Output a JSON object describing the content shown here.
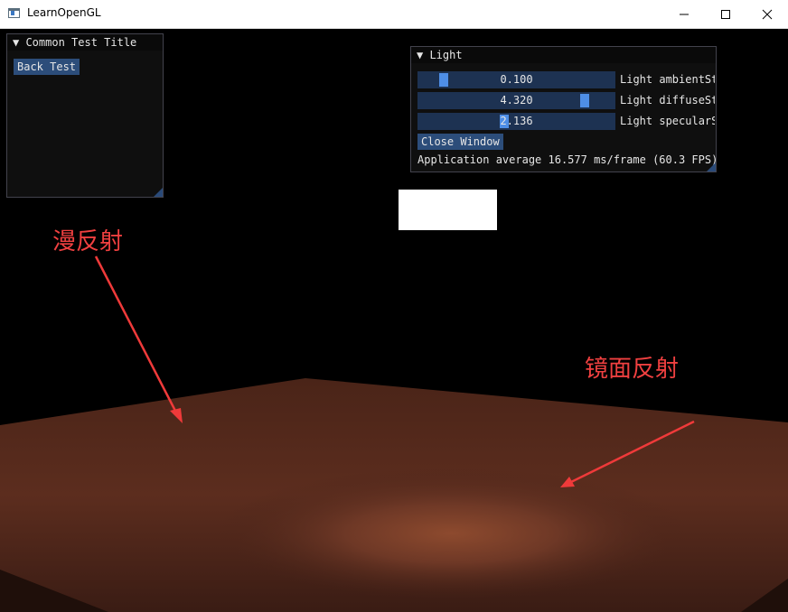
{
  "window": {
    "title": "LearnOpenGL"
  },
  "common_panel": {
    "header": "▼ Common Test Title",
    "back_button": "Back Test"
  },
  "light_panel": {
    "header": "▼ Light",
    "sliders": [
      {
        "value": "0.100",
        "label": "Light ambientSt",
        "level": 0.1
      },
      {
        "value": "4.320",
        "label": "Light diffuseSt",
        "level": 0.86
      },
      {
        "value": "2.136",
        "label": "Light specularS",
        "level": 0.43
      }
    ],
    "close_button": "Close Window",
    "stats": "Application average 16.577 ms/frame (60.3 FPS)"
  },
  "annotations": {
    "diffuse": "漫反射",
    "specular": "镜面反射"
  },
  "colors": {
    "annotation": "#f04040",
    "plane": "#6b3422",
    "slider_bg": "#1d3252",
    "slider_grab": "#4e8ee6",
    "button": "#2c4d7a"
  }
}
